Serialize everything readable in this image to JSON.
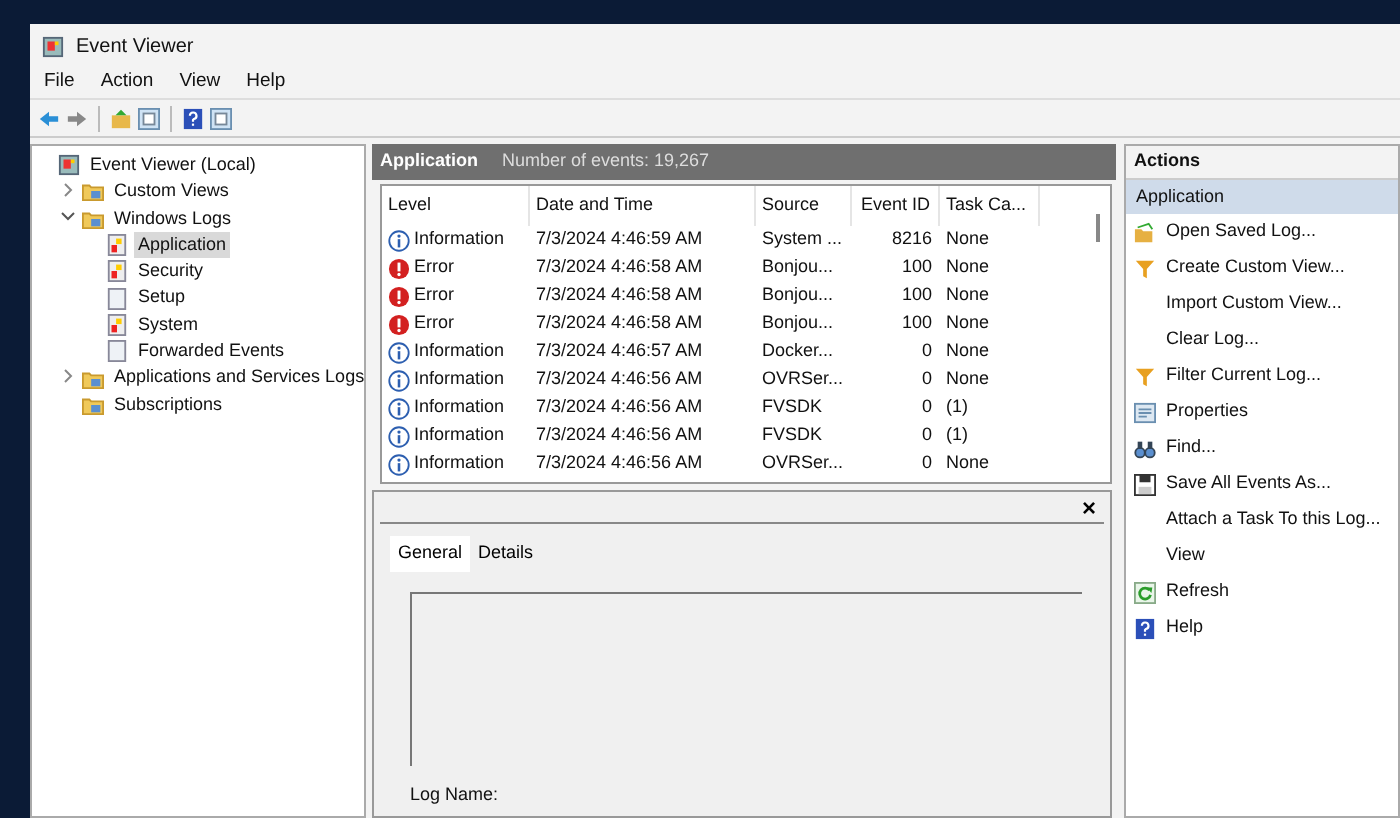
{
  "window": {
    "title": "Event Viewer"
  },
  "menu": [
    "File",
    "Action",
    "View",
    "Help"
  ],
  "toolbar": [
    {
      "kind": "back"
    },
    {
      "kind": "forward"
    },
    {
      "kind": "up"
    },
    {
      "kind": "panel"
    },
    {
      "kind": "help"
    },
    {
      "kind": "panel"
    }
  ],
  "tree": [
    {
      "label": "Event Viewer (Local)",
      "kind": "root",
      "selected": false,
      "children": [
        {
          "label": "Custom Views",
          "kind": "folder",
          "expanded": false,
          "selected": false
        },
        {
          "label": "Windows Logs",
          "kind": "folder",
          "expanded": true,
          "selected": false,
          "children": [
            {
              "label": "Application",
              "kind": "log",
              "selected": true
            },
            {
              "label": "Security",
              "kind": "log",
              "selected": false
            },
            {
              "label": "Setup",
              "kind": "plain",
              "selected": false
            },
            {
              "label": "System",
              "kind": "log",
              "selected": false
            },
            {
              "label": "Forwarded Events",
              "kind": "plain",
              "selected": false
            }
          ]
        },
        {
          "label": "Applications and Services Logs",
          "kind": "folder",
          "expanded": false,
          "selected": false
        },
        {
          "label": "Subscriptions",
          "kind": "folder",
          "selected": false
        }
      ]
    }
  ],
  "log_header": {
    "title": "Application",
    "count": "Number of events: 19,267"
  },
  "table": {
    "columns": [
      "Level",
      "Date and Time",
      "Source",
      "Event ID",
      "Task Ca..."
    ],
    "rows": [
      {
        "kind": "information",
        "level": "Information",
        "date": "7/3/2024 4:46:59 AM",
        "source": "System ...",
        "event_id": "8216",
        "task": "None"
      },
      {
        "kind": "error",
        "level": "Error",
        "date": "7/3/2024 4:46:58 AM",
        "source": "Bonjou...",
        "event_id": "100",
        "task": "None"
      },
      {
        "kind": "error",
        "level": "Error",
        "date": "7/3/2024 4:46:58 AM",
        "source": "Bonjou...",
        "event_id": "100",
        "task": "None"
      },
      {
        "kind": "error",
        "level": "Error",
        "date": "7/3/2024 4:46:58 AM",
        "source": "Bonjou...",
        "event_id": "100",
        "task": "None"
      },
      {
        "kind": "information",
        "level": "Information",
        "date": "7/3/2024 4:46:57 AM",
        "source": "Docker...",
        "event_id": "0",
        "task": "None"
      },
      {
        "kind": "information",
        "level": "Information",
        "date": "7/3/2024 4:46:56 AM",
        "source": "OVRSer...",
        "event_id": "0",
        "task": "None"
      },
      {
        "kind": "information",
        "level": "Information",
        "date": "7/3/2024 4:46:56 AM",
        "source": "FVSDK",
        "event_id": "0",
        "task": "(1)"
      },
      {
        "kind": "information",
        "level": "Information",
        "date": "7/3/2024 4:46:56 AM",
        "source": "FVSDK",
        "event_id": "0",
        "task": "(1)"
      },
      {
        "kind": "information",
        "level": "Information",
        "date": "7/3/2024 4:46:56 AM",
        "source": "OVRSer...",
        "event_id": "0",
        "task": "None"
      }
    ]
  },
  "details": {
    "close": "×",
    "tabs": [
      {
        "label": "General",
        "selected": true
      },
      {
        "label": "Details",
        "selected": false
      }
    ],
    "field_label": "Log Name:"
  },
  "actions": {
    "title": "Actions",
    "section": "Application",
    "items": [
      {
        "label": "Open Saved Log...",
        "kind": "open"
      },
      {
        "label": "Create Custom View...",
        "kind": "filter"
      },
      {
        "label": "Import Custom View...",
        "kind": "none"
      },
      {
        "label": "Clear Log...",
        "kind": "none"
      },
      {
        "label": "Filter Current Log...",
        "kind": "filter"
      },
      {
        "label": "Properties",
        "kind": "properties"
      },
      {
        "label": "Find...",
        "kind": "find"
      },
      {
        "label": "Save All Events As...",
        "kind": "save"
      },
      {
        "label": "Attach a Task To this Log...",
        "kind": "none"
      },
      {
        "label": "View",
        "kind": "none"
      },
      {
        "label": "Refresh",
        "kind": "refresh"
      },
      {
        "label": "Help",
        "kind": "help"
      }
    ]
  }
}
